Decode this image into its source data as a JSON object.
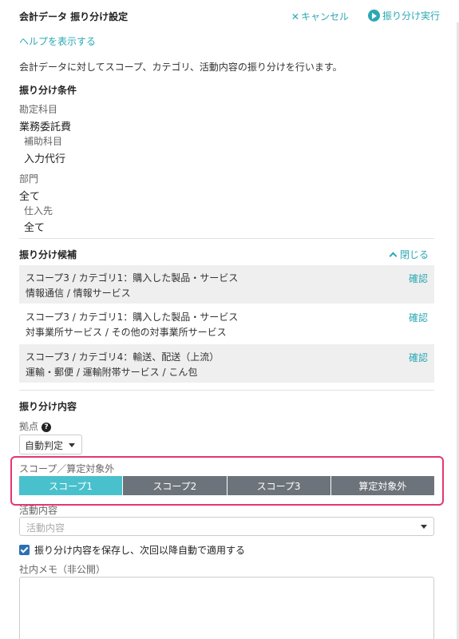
{
  "header": {
    "title": "会計データ 振り分け設定",
    "cancel_label": "キャンセル",
    "execute_label": "振り分け実行"
  },
  "help_link": "ヘルプを表示する",
  "description": "会計データに対してスコープ、カテゴリ、活動内容の振り分けを行います。",
  "conditions": {
    "title": "振り分け条件",
    "account_label": "勘定科目",
    "account_value": "業務委託費",
    "sub_account_label": "補助科目",
    "sub_account_value": "入力代行",
    "department_label": "部門",
    "department_value": "全て",
    "supplier_label": "仕入先",
    "supplier_value": "全て"
  },
  "candidates": {
    "title": "振り分け候補",
    "close_label": "閉じる",
    "confirm_label": "確認",
    "items": [
      {
        "line1": "スコープ3 / カテゴリ1：購入した製品・サービス",
        "line2": "情報通信 / 情報サービス"
      },
      {
        "line1": "スコープ3 / カテゴリ1：購入した製品・サービス",
        "line2": "対事業所サービス / その他の対事業所サービス"
      },
      {
        "line1": "スコープ3 / カテゴリ4：輸送、配送（上流）",
        "line2": "運輸・郵便 / 運輸附帯サービス / こん包"
      }
    ]
  },
  "content": {
    "title": "振り分け内容",
    "base_label": "拠点",
    "base_value": "自動判定",
    "scope_label": "スコープ／算定対象外",
    "scope_options": [
      "スコープ1",
      "スコープ2",
      "スコープ3",
      "算定対象外"
    ],
    "scope_selected": "スコープ1",
    "activity_label": "活動内容",
    "activity_placeholder": "活動内容",
    "save_checkbox_label": "振り分け内容を保存し、次回以降自動で適用する",
    "save_checked": true,
    "memo_label": "社内メモ（非公開）",
    "memo_value": ""
  },
  "colors": {
    "accent": "#2ba8b4",
    "segment_active": "#49c1cc",
    "segment_inactive": "#6d737a",
    "highlight": "#e4376e"
  }
}
